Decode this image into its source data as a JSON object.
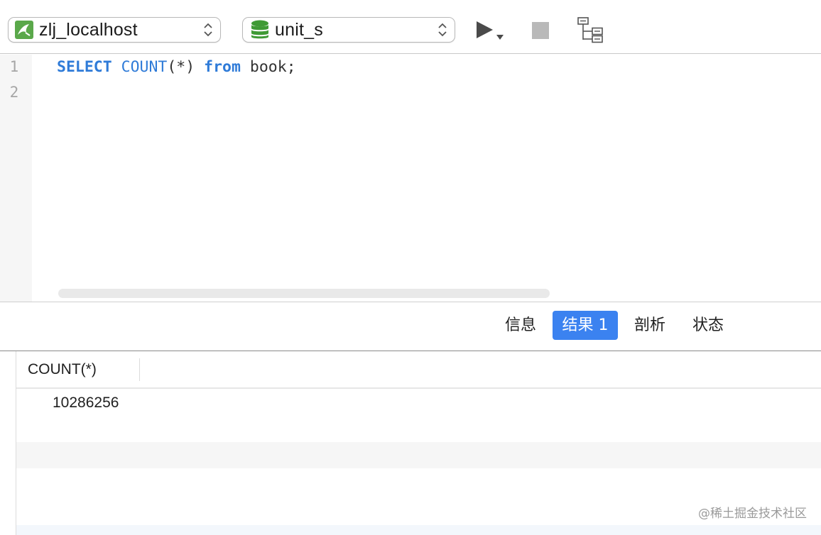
{
  "toolbar": {
    "connection": {
      "label": "zlj_localhost",
      "icon": "mysql-connection-icon",
      "color": "#5aa84a"
    },
    "database": {
      "label": "unit_s",
      "icon": "database-icon",
      "color": "#3f9a35"
    },
    "run_icon": "run-icon",
    "stop_icon": "stop-icon",
    "explain_icon": "explain-icon"
  },
  "editor": {
    "line_numbers": [
      "1",
      "2"
    ],
    "code": {
      "kw_select": "SELECT",
      "fn_count": "COUNT",
      "args": "(*)",
      "kw_from": "from",
      "rest": " book;"
    }
  },
  "tabs": [
    {
      "label": "信息",
      "active": false
    },
    {
      "label": "结果 1",
      "active": true
    },
    {
      "label": "剖析",
      "active": false
    },
    {
      "label": "状态",
      "active": false
    }
  ],
  "result": {
    "columns": [
      "COUNT(*)"
    ],
    "rows": [
      [
        "10286256"
      ]
    ]
  },
  "watermark": "@稀土掘金技术社区",
  "colors": {
    "accent": "#3b82f0",
    "keyword": "#2f7bd8"
  }
}
